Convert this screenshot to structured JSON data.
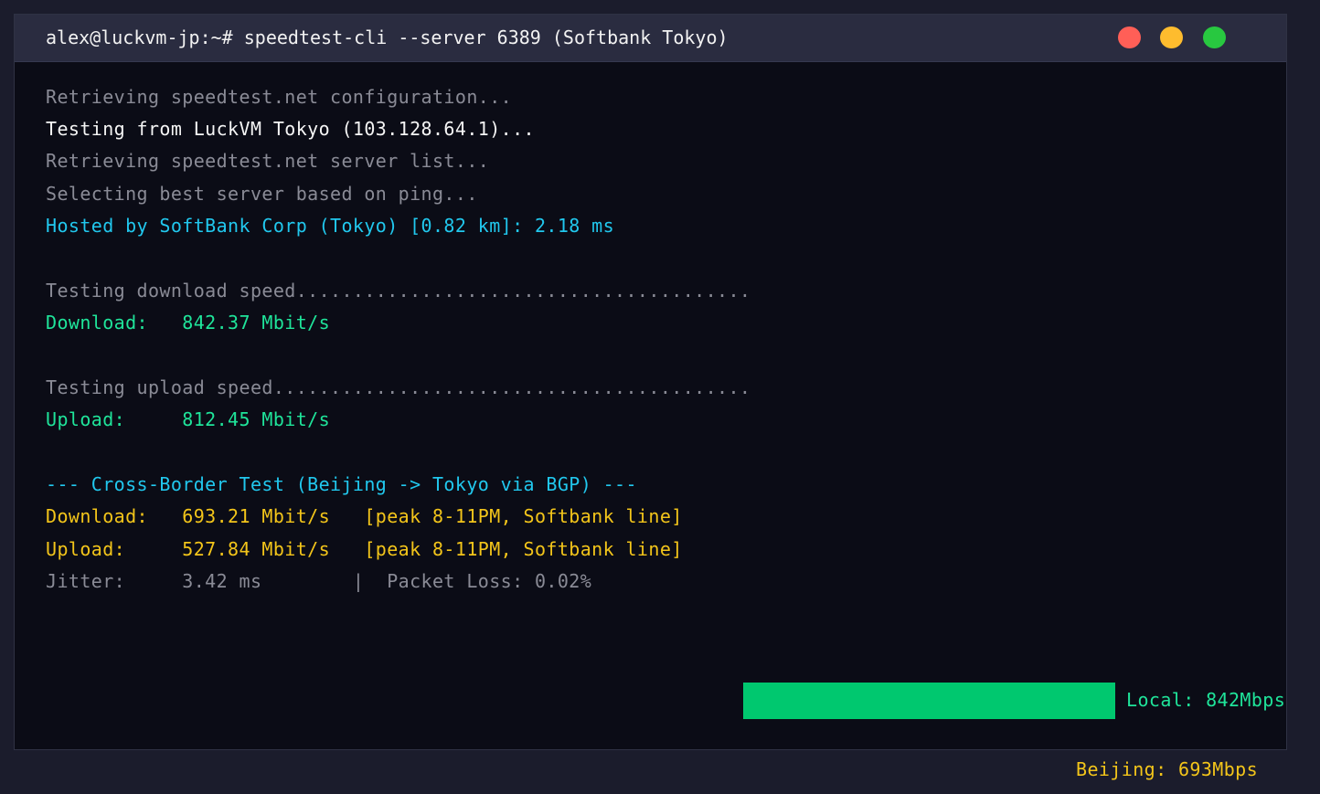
{
  "window": {
    "title": "alex@luckvm-jp:~# speedtest-cli --server 6389 (Softbank Tokyo)",
    "buttons": {
      "close_color": "#ff5f57",
      "minimize_color": "#febc2e",
      "maximize_color": "#28c840"
    }
  },
  "colors": {
    "background": "#1b1c2c",
    "terminal_bg": "#0b0c16",
    "gray": "#8a8b96",
    "cyan": "#21c8ee",
    "green": "#1fe49a",
    "yellow": "#f3c51a",
    "bar_green": "#00c86f"
  },
  "output": {
    "retrieving_config": "Retrieving speedtest.net configuration...",
    "testing_from": "Testing from LuckVM Tokyo (103.128.64.1)...",
    "retrieving_servers": "Retrieving speedtest.net server list...",
    "selecting_server": "Selecting best server based on ping...",
    "hosted_by": "Hosted by SoftBank Corp (Tokyo) [0.82 km]: 2.18 ms",
    "testing_download": "Testing download speed........................................",
    "download_result": "Download:   842.37 Mbit/s",
    "testing_upload": "Testing upload speed..........................................",
    "upload_result": "Upload:     812.45 Mbit/s",
    "cross_border_header": "--- Cross-Border Test (Beijing -> Tokyo via BGP) ---",
    "cb_download": "Download:   693.21 Mbit/s   [peak 8-11PM, Softbank line]",
    "cb_upload": "Upload:     527.84 Mbit/s   [peak 8-11PM, Softbank line]",
    "jitter_line": "Jitter:     3.42 ms        |  Packet Loss: 0.02%"
  },
  "comparison": {
    "local_label": "Local: 842Mbps",
    "beijing_label": "Beijing: 693Mbps"
  }
}
